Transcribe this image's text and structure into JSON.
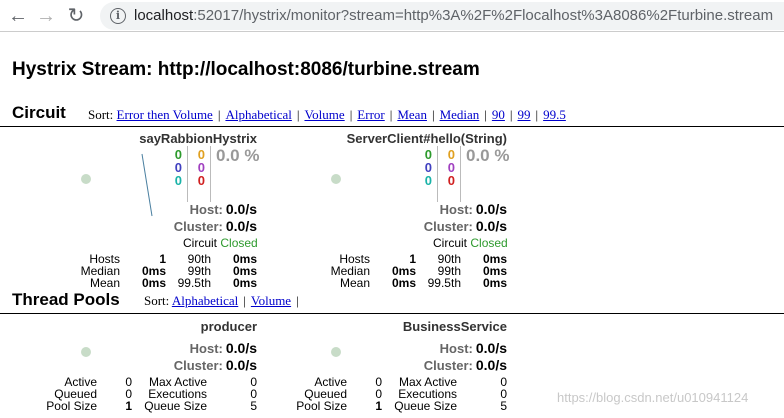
{
  "browser": {
    "url_host": "localhost",
    "url_rest": ":52017/hystrix/monitor?stream=http%3A%2F%2Flocalhost%3A8086%2Fturbine.stream"
  },
  "page": {
    "title": "Hystrix Stream: http://localhost:8086/turbine.stream"
  },
  "circuit": {
    "heading": "Circuit",
    "sort_label": "Sort:",
    "sort_options": [
      "Error then Volume",
      "Alphabetical",
      "Volume",
      "Error",
      "Mean",
      "Median",
      "90",
      "99",
      "99.5"
    ],
    "monitors": [
      {
        "name": "sayRabbionHystrix",
        "counts_left": [
          "0",
          "0",
          "0"
        ],
        "counts_right": [
          "0",
          "0",
          "0"
        ],
        "error_rate": "0.0 %",
        "host_label": "Host:",
        "host_value": "0.0/s",
        "cluster_label": "Cluster:",
        "cluster_value": "0.0/s",
        "circuit_label": "Circuit",
        "circuit_state": "Closed",
        "hosts_label": "Hosts",
        "hosts_value": "1",
        "median_label": "Median",
        "median_value": "0ms",
        "mean_label": "Mean",
        "mean_value": "0ms",
        "p90_label": "90th",
        "p90_value": "0ms",
        "p99_label": "99th",
        "p99_value": "0ms",
        "p995_label": "99.5th",
        "p995_value": "0ms"
      },
      {
        "name": "ServerClient#hello(String)",
        "counts_left": [
          "0",
          "0",
          "0"
        ],
        "counts_right": [
          "0",
          "0",
          "0"
        ],
        "error_rate": "0.0 %",
        "host_label": "Host:",
        "host_value": "0.0/s",
        "cluster_label": "Cluster:",
        "cluster_value": "0.0/s",
        "circuit_label": "Circuit",
        "circuit_state": "Closed",
        "hosts_label": "Hosts",
        "hosts_value": "1",
        "median_label": "Median",
        "median_value": "0ms",
        "mean_label": "Mean",
        "mean_value": "0ms",
        "p90_label": "90th",
        "p90_value": "0ms",
        "p99_label": "99th",
        "p99_value": "0ms",
        "p995_label": "99.5th",
        "p995_value": "0ms"
      }
    ]
  },
  "thread_pools": {
    "heading": "Thread Pools",
    "sort_label": "Sort:",
    "sort_options": [
      "Alphabetical",
      "Volume"
    ],
    "monitors": [
      {
        "name": "producer",
        "host_label": "Host:",
        "host_value": "0.0/s",
        "cluster_label": "Cluster:",
        "cluster_value": "0.0/s",
        "active_label": "Active",
        "active_value": "0",
        "queued_label": "Queued",
        "queued_value": "0",
        "poolsize_label": "Pool Size",
        "poolsize_value": "1",
        "maxactive_label": "Max Active",
        "maxactive_value": "0",
        "executions_label": "Executions",
        "executions_value": "0",
        "queuesize_label": "Queue Size",
        "queuesize_value": "5"
      },
      {
        "name": "BusinessService",
        "host_label": "Host:",
        "host_value": "0.0/s",
        "cluster_label": "Cluster:",
        "cluster_value": "0.0/s",
        "active_label": "Active",
        "active_value": "0",
        "queued_label": "Queued",
        "queued_value": "0",
        "poolsize_label": "Pool Size",
        "poolsize_value": "1",
        "maxactive_label": "Max Active",
        "maxactive_value": "0",
        "executions_label": "Executions",
        "executions_value": "0",
        "queuesize_label": "Queue Size",
        "queuesize_value": "5"
      }
    ]
  },
  "watermark": "https://blog.csdn.net/u010941124",
  "colors": {
    "success": "#2d9a2d",
    "link": "#0000cc",
    "health_dot": "#c8dcc8"
  }
}
